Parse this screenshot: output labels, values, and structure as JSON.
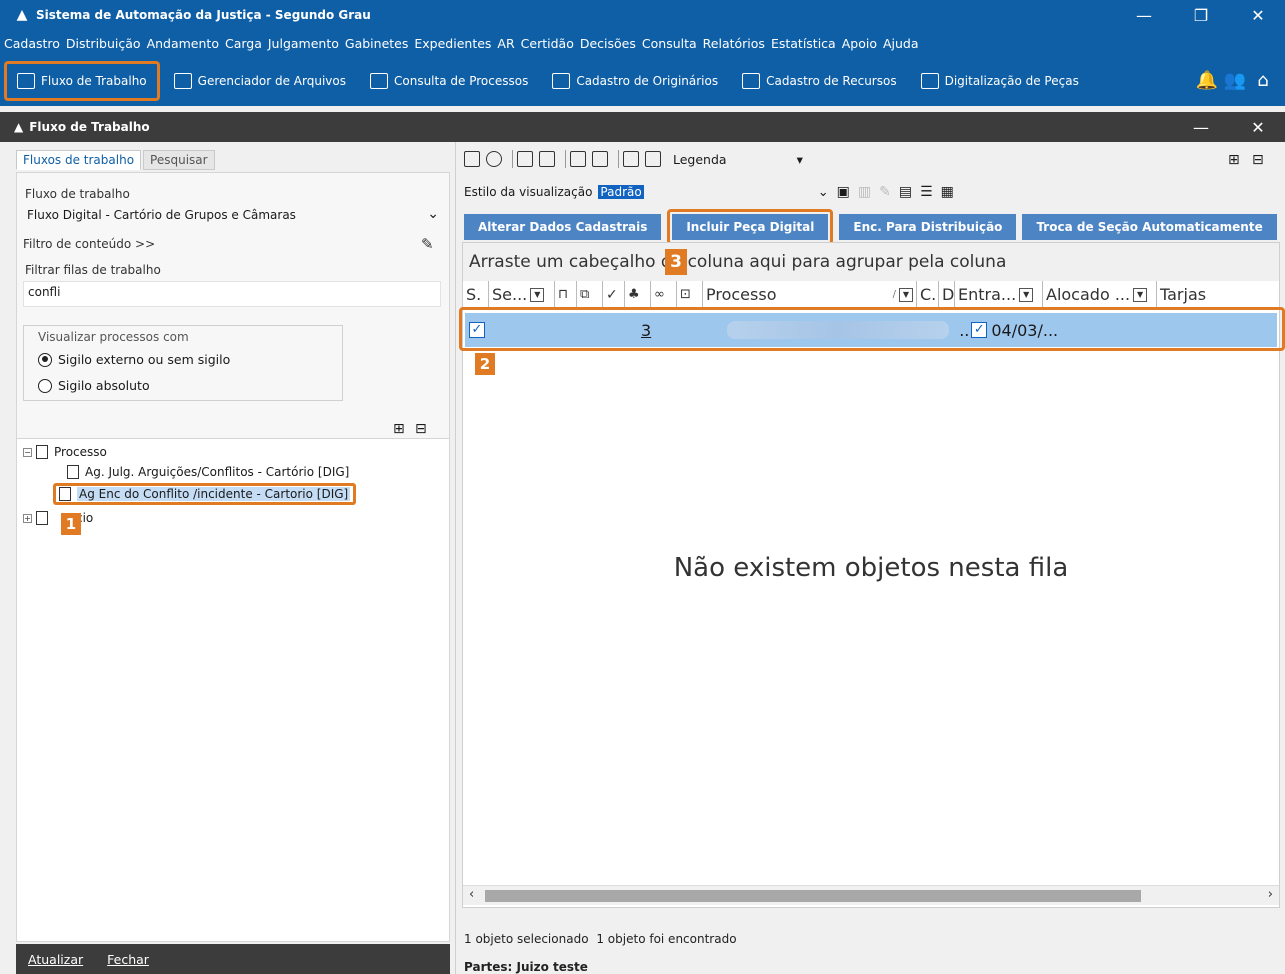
{
  "window": {
    "title": "Sistema de Automação da Justiça - Segundo Grau",
    "minimize": "—",
    "restore": "❐",
    "close": "✕"
  },
  "menu": [
    "Cadastro",
    "Distribuição",
    "Andamento",
    "Carga",
    "Julgamento",
    "Gabinetes",
    "Expedientes",
    "AR",
    "Certidão",
    "Decisões",
    "Consulta",
    "Relatórios",
    "Estatística",
    "Apoio",
    "Ajuda"
  ],
  "toolbar": {
    "fluxo": "Fluxo de Trabalho",
    "gerenciador": "Gerenciador de Arquivos",
    "consulta": "Consulta de Processos",
    "originarios": "Cadastro de Originários",
    "recursos": "Cadastro de Recursos",
    "digitalizacao": "Digitalização de Peças"
  },
  "subwindow": {
    "title": "Fluxo de Trabalho",
    "minimize": "—",
    "close": "✕"
  },
  "left": {
    "tab_fluxos": "Fluxos de trabalho",
    "tab_pesquisar": "Pesquisar",
    "fluxo_label": "Fluxo de trabalho",
    "fluxo_value": "Fluxo Digital - Cartório de Grupos e Câmaras",
    "filtro_conteudo": "Filtro de conteúdo >>",
    "filtrar_label": "Filtrar filas de trabalho",
    "filtrar_value": "confli",
    "visualizar_label": "Visualizar processos com",
    "radio1": "Sigilo externo ou sem sigilo",
    "radio2": "Sigilo absoluto",
    "tree": {
      "root": "Processo",
      "child1": "Ag. Julg. Arguições/Conflitos - Cartório [DIG]",
      "child2": "Ag Enc do Conflito /incidente - Cartorio [DIG]",
      "root2": "cio"
    },
    "footer_atualizar": "Atualizar",
    "footer_fechar": "Fechar"
  },
  "badges": [
    "1",
    "2",
    "3"
  ],
  "right": {
    "legenda": "Legenda",
    "estilo_label": "Estilo da visualização",
    "estilo_value": "Padrão",
    "actions": {
      "alterar": "Alterar Dados Cadastrais",
      "incluir": "Incluir Peça Digital",
      "enc": "Enc. Para Distribuição",
      "troca": "Troca de Seção Automaticamente"
    },
    "grouping_hint": "Arraste um cabeçalho de coluna aqui para agrupar pela coluna",
    "columns": {
      "s": "S.",
      "se": "Se...",
      "processo": "Processo",
      "c": "C.",
      "d": "D",
      "entrada": "Entra...",
      "alocado": "Alocado ...",
      "tarjas": "Tarjas"
    },
    "row": {
      "number": "3",
      "ellipsis": "..",
      "date": "04/03/..."
    },
    "empty": "Não existem objetos nesta fila",
    "status_selected": "1 objeto selecionado",
    "status_found": "1 objeto foi encontrado",
    "partes": "Partes: Juizo teste"
  }
}
